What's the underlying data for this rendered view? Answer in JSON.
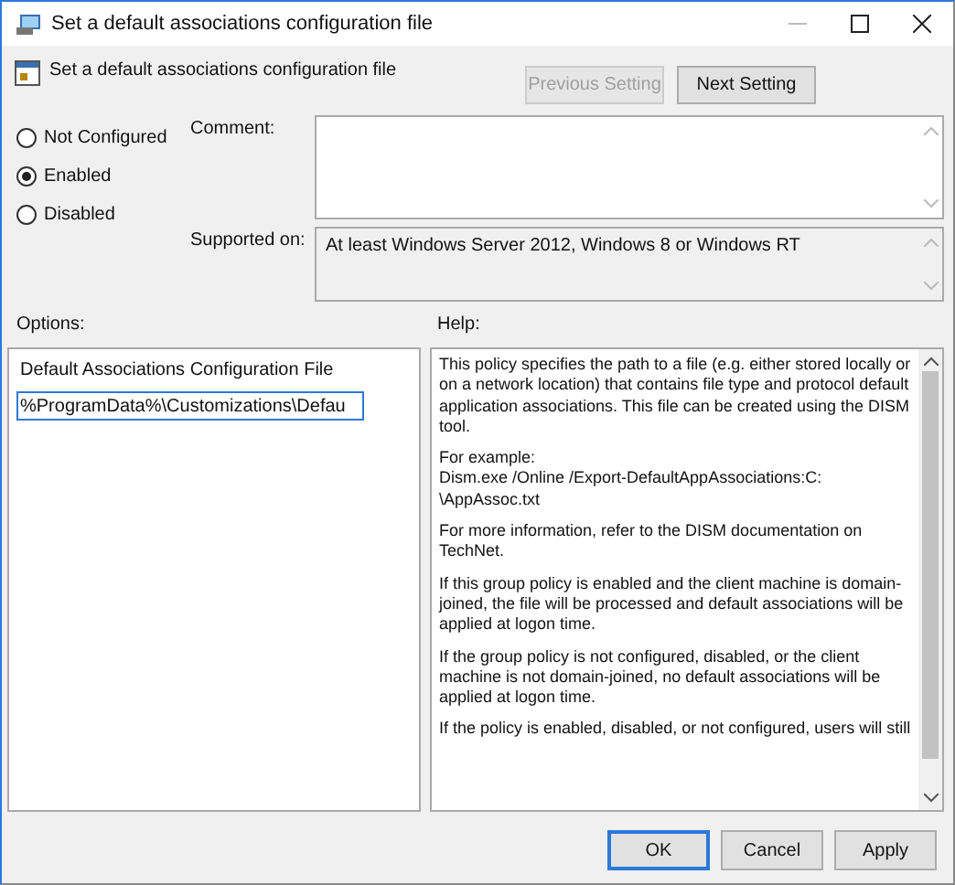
{
  "window": {
    "title": "Set a default associations configuration file"
  },
  "header": {
    "title": "Set a default associations configuration file",
    "buttons": [
      {
        "label": "Previous Setting",
        "disabled": true
      },
      {
        "label": "Next Setting",
        "disabled": false
      }
    ]
  },
  "state_options": [
    {
      "label": "Not Configured",
      "selected": false
    },
    {
      "label": "Enabled",
      "selected": true
    },
    {
      "label": "Disabled",
      "selected": false
    }
  ],
  "comment": {
    "label": "Comment:"
  },
  "supported_on": {
    "label": "Supported on:",
    "value": "At least Windows Server 2012, Windows 8 or Windows RT"
  },
  "options": {
    "title": "Options:",
    "field_label": "Default Associations Configuration File",
    "field_value": "%ProgramData%\\Customizations\\Defau"
  },
  "help": {
    "title": "Help:",
    "paragraphs": [
      "This policy specifies the path to a file (e.g. either stored locally or on a network location) that contains file type and protocol default application associations. This file can be created using the DISM tool.",
      "For example:\nDism.exe /Online /Export-DefaultAppAssociations:C:\n\\AppAssoc.txt",
      "For more information, refer to the DISM documentation on TechNet.",
      "If this group policy is enabled and the client machine is domain-joined, the file will be processed and default associations will be applied at logon time.",
      "If the group policy is not configured, disabled, or the client machine is not domain-joined, no default associations will be applied at logon time.",
      "If the policy is enabled, disabled, or not configured, users will still"
    ]
  },
  "footer_buttons": [
    {
      "label": "OK",
      "default": true
    },
    {
      "label": "Cancel",
      "default": false
    },
    {
      "label": "Apply",
      "default": false
    }
  ]
}
